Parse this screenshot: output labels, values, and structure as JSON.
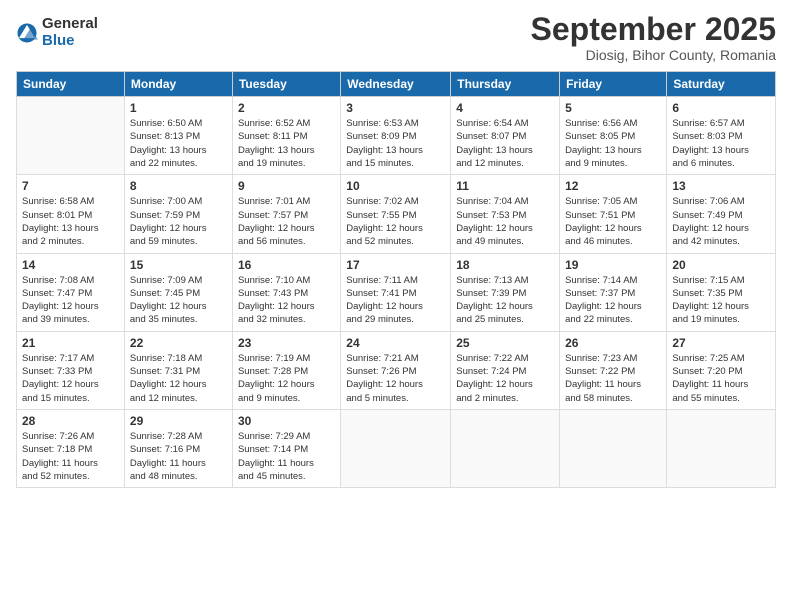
{
  "logo": {
    "general": "General",
    "blue": "Blue"
  },
  "header": {
    "month": "September 2025",
    "location": "Diosig, Bihor County, Romania"
  },
  "weekdays": [
    "Sunday",
    "Monday",
    "Tuesday",
    "Wednesday",
    "Thursday",
    "Friday",
    "Saturday"
  ],
  "weeks": [
    [
      {
        "day": "",
        "info": ""
      },
      {
        "day": "1",
        "info": "Sunrise: 6:50 AM\nSunset: 8:13 PM\nDaylight: 13 hours\nand 22 minutes."
      },
      {
        "day": "2",
        "info": "Sunrise: 6:52 AM\nSunset: 8:11 PM\nDaylight: 13 hours\nand 19 minutes."
      },
      {
        "day": "3",
        "info": "Sunrise: 6:53 AM\nSunset: 8:09 PM\nDaylight: 13 hours\nand 15 minutes."
      },
      {
        "day": "4",
        "info": "Sunrise: 6:54 AM\nSunset: 8:07 PM\nDaylight: 13 hours\nand 12 minutes."
      },
      {
        "day": "5",
        "info": "Sunrise: 6:56 AM\nSunset: 8:05 PM\nDaylight: 13 hours\nand 9 minutes."
      },
      {
        "day": "6",
        "info": "Sunrise: 6:57 AM\nSunset: 8:03 PM\nDaylight: 13 hours\nand 6 minutes."
      }
    ],
    [
      {
        "day": "7",
        "info": "Sunrise: 6:58 AM\nSunset: 8:01 PM\nDaylight: 13 hours\nand 2 minutes."
      },
      {
        "day": "8",
        "info": "Sunrise: 7:00 AM\nSunset: 7:59 PM\nDaylight: 12 hours\nand 59 minutes."
      },
      {
        "day": "9",
        "info": "Sunrise: 7:01 AM\nSunset: 7:57 PM\nDaylight: 12 hours\nand 56 minutes."
      },
      {
        "day": "10",
        "info": "Sunrise: 7:02 AM\nSunset: 7:55 PM\nDaylight: 12 hours\nand 52 minutes."
      },
      {
        "day": "11",
        "info": "Sunrise: 7:04 AM\nSunset: 7:53 PM\nDaylight: 12 hours\nand 49 minutes."
      },
      {
        "day": "12",
        "info": "Sunrise: 7:05 AM\nSunset: 7:51 PM\nDaylight: 12 hours\nand 46 minutes."
      },
      {
        "day": "13",
        "info": "Sunrise: 7:06 AM\nSunset: 7:49 PM\nDaylight: 12 hours\nand 42 minutes."
      }
    ],
    [
      {
        "day": "14",
        "info": "Sunrise: 7:08 AM\nSunset: 7:47 PM\nDaylight: 12 hours\nand 39 minutes."
      },
      {
        "day": "15",
        "info": "Sunrise: 7:09 AM\nSunset: 7:45 PM\nDaylight: 12 hours\nand 35 minutes."
      },
      {
        "day": "16",
        "info": "Sunrise: 7:10 AM\nSunset: 7:43 PM\nDaylight: 12 hours\nand 32 minutes."
      },
      {
        "day": "17",
        "info": "Sunrise: 7:11 AM\nSunset: 7:41 PM\nDaylight: 12 hours\nand 29 minutes."
      },
      {
        "day": "18",
        "info": "Sunrise: 7:13 AM\nSunset: 7:39 PM\nDaylight: 12 hours\nand 25 minutes."
      },
      {
        "day": "19",
        "info": "Sunrise: 7:14 AM\nSunset: 7:37 PM\nDaylight: 12 hours\nand 22 minutes."
      },
      {
        "day": "20",
        "info": "Sunrise: 7:15 AM\nSunset: 7:35 PM\nDaylight: 12 hours\nand 19 minutes."
      }
    ],
    [
      {
        "day": "21",
        "info": "Sunrise: 7:17 AM\nSunset: 7:33 PM\nDaylight: 12 hours\nand 15 minutes."
      },
      {
        "day": "22",
        "info": "Sunrise: 7:18 AM\nSunset: 7:31 PM\nDaylight: 12 hours\nand 12 minutes."
      },
      {
        "day": "23",
        "info": "Sunrise: 7:19 AM\nSunset: 7:28 PM\nDaylight: 12 hours\nand 9 minutes."
      },
      {
        "day": "24",
        "info": "Sunrise: 7:21 AM\nSunset: 7:26 PM\nDaylight: 12 hours\nand 5 minutes."
      },
      {
        "day": "25",
        "info": "Sunrise: 7:22 AM\nSunset: 7:24 PM\nDaylight: 12 hours\nand 2 minutes."
      },
      {
        "day": "26",
        "info": "Sunrise: 7:23 AM\nSunset: 7:22 PM\nDaylight: 11 hours\nand 58 minutes."
      },
      {
        "day": "27",
        "info": "Sunrise: 7:25 AM\nSunset: 7:20 PM\nDaylight: 11 hours\nand 55 minutes."
      }
    ],
    [
      {
        "day": "28",
        "info": "Sunrise: 7:26 AM\nSunset: 7:18 PM\nDaylight: 11 hours\nand 52 minutes."
      },
      {
        "day": "29",
        "info": "Sunrise: 7:28 AM\nSunset: 7:16 PM\nDaylight: 11 hours\nand 48 minutes."
      },
      {
        "day": "30",
        "info": "Sunrise: 7:29 AM\nSunset: 7:14 PM\nDaylight: 11 hours\nand 45 minutes."
      },
      {
        "day": "",
        "info": ""
      },
      {
        "day": "",
        "info": ""
      },
      {
        "day": "",
        "info": ""
      },
      {
        "day": "",
        "info": ""
      }
    ]
  ]
}
